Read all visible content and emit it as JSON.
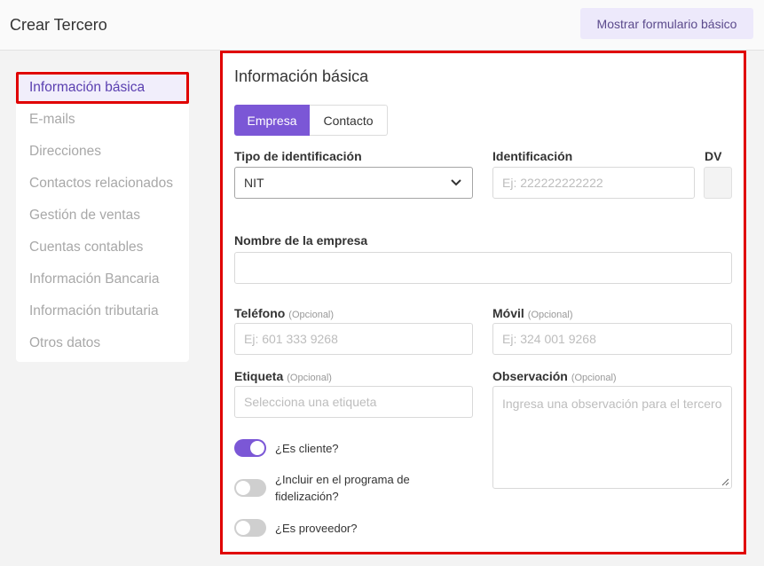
{
  "header": {
    "title": "Crear Tercero",
    "basic_form_button": "Mostrar formulario básico"
  },
  "sidebar": {
    "items": [
      {
        "label": "Información básica",
        "active": true
      },
      {
        "label": "E-mails"
      },
      {
        "label": "Direcciones"
      },
      {
        "label": "Contactos relacionados"
      },
      {
        "label": "Gestión de ventas"
      },
      {
        "label": "Cuentas contables"
      },
      {
        "label": "Información Bancaria"
      },
      {
        "label": "Información tributaria"
      },
      {
        "label": "Otros datos"
      }
    ]
  },
  "form": {
    "section_title": "Información básica",
    "type_tabs": [
      "Empresa",
      "Contacto"
    ],
    "selected_tab": "Empresa",
    "id_type": {
      "label": "Tipo de identificación",
      "value": "NIT"
    },
    "identification": {
      "label": "Identificación",
      "placeholder": "Ej: 222222222222"
    },
    "dv": {
      "label": "DV"
    },
    "company_name": {
      "label": "Nombre de la empresa",
      "value": ""
    },
    "phone": {
      "label": "Teléfono",
      "optional": "(Opcional)",
      "placeholder": "Ej: 601 333 9268"
    },
    "mobile": {
      "label": "Móvil",
      "optional": "(Opcional)",
      "placeholder": "Ej: 324 001 9268"
    },
    "tag": {
      "label": "Etiqueta",
      "optional": "(Opcional)",
      "placeholder": "Selecciona una etiqueta"
    },
    "observation": {
      "label": "Observación",
      "optional": "(Opcional)",
      "placeholder": "Ingresa una observación para el tercero"
    },
    "toggles": [
      {
        "label": "¿Es cliente?",
        "on": true
      },
      {
        "label": "¿Incluir en el programa de fidelización?",
        "on": false
      },
      {
        "label": "¿Es proveedor?",
        "on": false
      }
    ]
  },
  "colors": {
    "accent": "#7b57d6",
    "highlight": "#e00000"
  }
}
